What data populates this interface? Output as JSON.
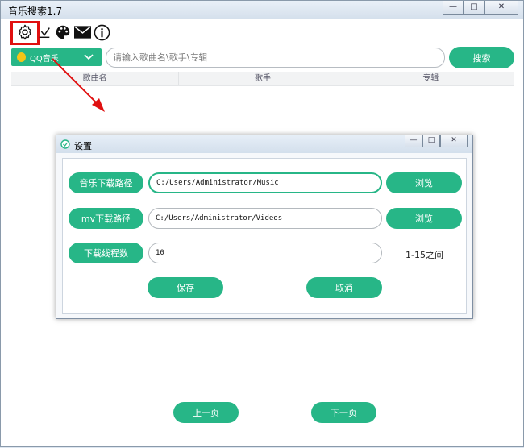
{
  "window": {
    "title": "音乐搜索1.7",
    "controls": {
      "minimize": "—",
      "maximize": "□",
      "close": "✕"
    }
  },
  "toolbar": {
    "icons": [
      "gear-icon",
      "download-icon",
      "palette-icon",
      "mail-icon",
      "info-icon"
    ],
    "highlight_color": "#e01010"
  },
  "search": {
    "source_label": "QQ音乐",
    "placeholder": "请输入歌曲名\\歌手\\专辑",
    "value": "",
    "button_label": "搜索"
  },
  "results": {
    "columns": [
      "歌曲名",
      "歌手",
      "专辑"
    ]
  },
  "settings": {
    "title": "设置",
    "music_path_label": "音乐下载路径",
    "music_path_value": "C:/Users/Administrator/Music",
    "mv_path_label": "mv下载路径",
    "mv_path_value": "C:/Users/Administrator/Videos",
    "threads_label": "下载线程数",
    "threads_value": "10",
    "threads_range": "1-15之间",
    "browse_label": "浏览",
    "save_label": "保存",
    "cancel_label": "取消"
  },
  "pagination": {
    "prev_label": "上一页",
    "next_label": "下一页"
  },
  "colors": {
    "accent": "#27b687",
    "highlight": "#e01010"
  }
}
